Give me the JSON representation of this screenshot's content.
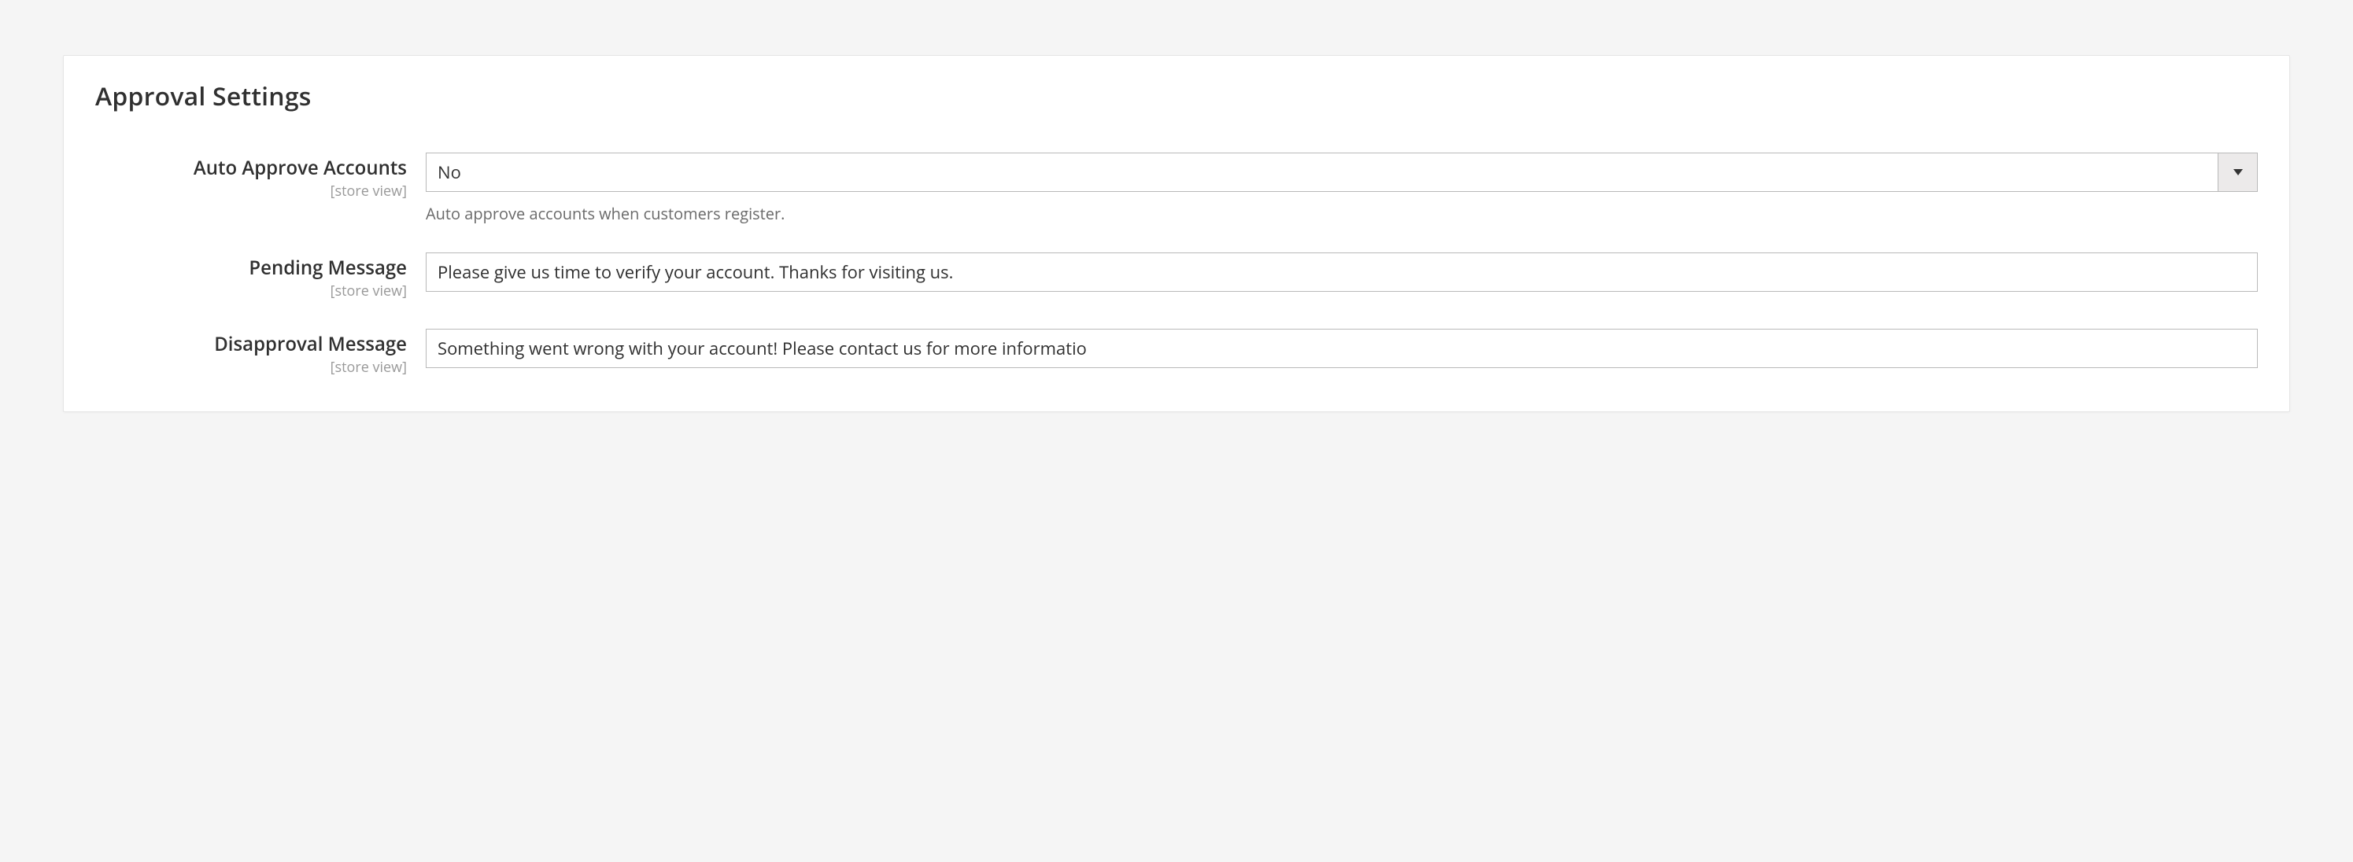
{
  "section": {
    "title": "Approval Settings"
  },
  "scope_label": "[store view]",
  "fields": {
    "auto_approve": {
      "label": "Auto Approve Accounts",
      "value": "No",
      "help": "Auto approve accounts when customers register."
    },
    "pending_message": {
      "label": "Pending Message",
      "value": "Please give us time to verify your account. Thanks for visiting us."
    },
    "disapproval_message": {
      "label": "Disapproval Message",
      "value": "Something went wrong with your account! Please contact us for more informatio"
    }
  }
}
